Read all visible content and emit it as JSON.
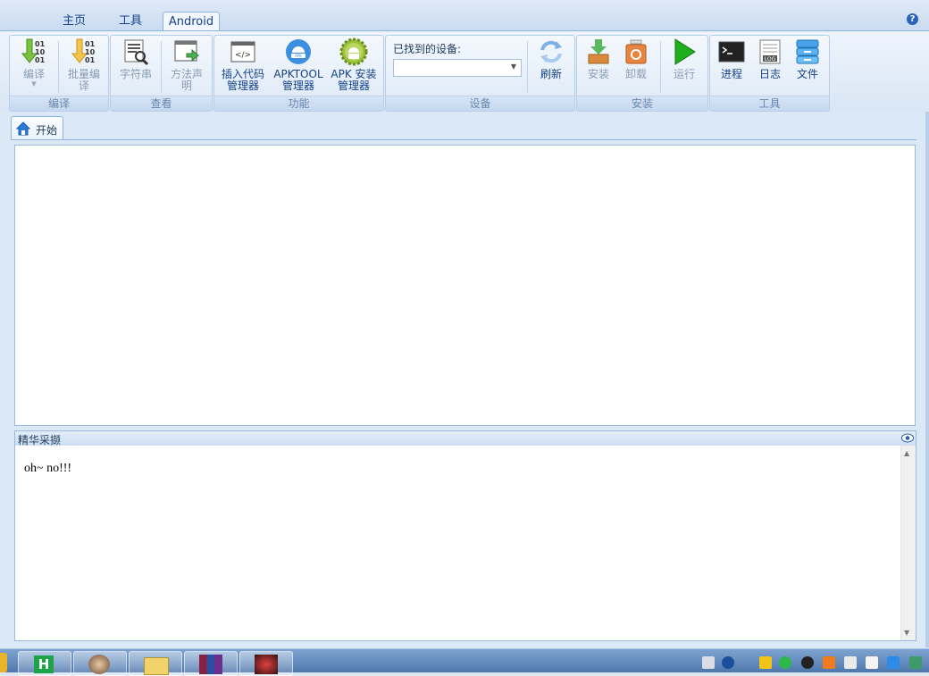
{
  "ribbon_tabs": [
    {
      "label": "主页",
      "active": false
    },
    {
      "label": "工具",
      "active": false
    },
    {
      "label": "Android",
      "active": true
    }
  ],
  "help_label": "?",
  "groups": {
    "compile": {
      "label": "编译",
      "buttons": [
        {
          "line1": "编译",
          "line2": "",
          "disabled": true,
          "has_dropdown": true
        },
        {
          "line1": "批量编",
          "line2": "译",
          "disabled": true
        }
      ]
    },
    "view": {
      "label": "查看",
      "buttons": [
        {
          "line1": "字符串",
          "line2": "",
          "disabled": true
        },
        {
          "line1": "方法声",
          "line2": "明",
          "disabled": true
        }
      ]
    },
    "function": {
      "label": "功能",
      "buttons": [
        {
          "line1": "插入代码",
          "line2": "管理器"
        },
        {
          "line1": "APKTOOL",
          "line2": "管理器"
        },
        {
          "line1": "APK 安装",
          "line2": "管理器"
        }
      ]
    },
    "device": {
      "label": "设备",
      "found_label": "已找到的设备:",
      "combo_value": "",
      "refresh_label": "刷新"
    },
    "install": {
      "label": "安装",
      "buttons": [
        {
          "line1": "安装",
          "disabled": true
        },
        {
          "line1": "卸载",
          "disabled": true
        },
        {
          "line1": "运行",
          "disabled": true
        }
      ]
    },
    "tools": {
      "label": "工具",
      "buttons": [
        {
          "line1": "进程"
        },
        {
          "line1": "日志"
        },
        {
          "line1": "文件"
        }
      ]
    }
  },
  "icon_text": {
    "binary": [
      "01",
      "10",
      "01"
    ],
    "code": "</>",
    "apk": "APK",
    "log": "LOG",
    "pin": "H"
  },
  "doc_tab": {
    "label": "开始",
    "icon": "home-icon"
  },
  "bottom_panel": {
    "title": "精华采撷",
    "content": "oh~ no!!!"
  },
  "colors": {
    "accent": "#15428b",
    "disabled": "#8a9bb3",
    "ribbon_border": "#8db2e3"
  }
}
